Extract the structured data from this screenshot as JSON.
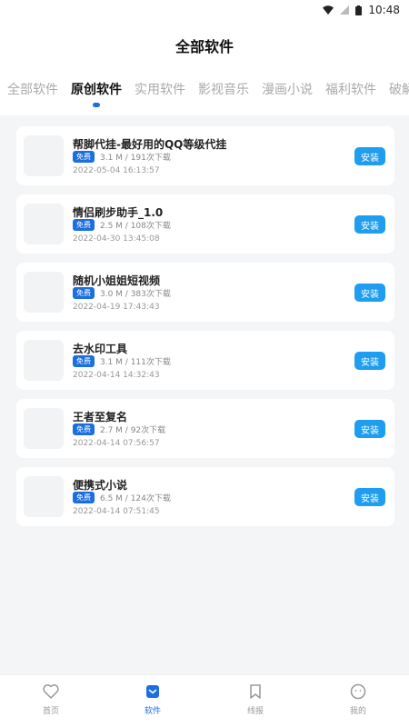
{
  "status_bar": {
    "time": "10:48"
  },
  "header": {
    "title": "全部软件"
  },
  "tabs": [
    {
      "label": "全部软件"
    },
    {
      "label": "原创软件"
    },
    {
      "label": "实用软件"
    },
    {
      "label": "影视音乐"
    },
    {
      "label": "漫画小说"
    },
    {
      "label": "福利软件"
    },
    {
      "label": "破解"
    }
  ],
  "active_tab": "原创软件",
  "items": [
    {
      "title": "帮脚代挂-最好用的QQ等级代挂",
      "badge": "免费",
      "meta": "3.1 M / 191次下载",
      "date": "2022-05-04 16:13:57",
      "install_label": "安装"
    },
    {
      "title": "情侣刷步助手_1.0",
      "badge": "免费",
      "meta": "2.5 M / 108次下载",
      "date": "2022-04-30 13:45:08",
      "install_label": "安装"
    },
    {
      "title": "随机小姐姐短视频",
      "badge": "免费",
      "meta": "3.0 M / 383次下载",
      "date": "2022-04-19 17:43:43",
      "install_label": "安装"
    },
    {
      "title": "去水印工具",
      "badge": "免费",
      "meta": "3.1 M / 111次下载",
      "date": "2022-04-14 14:32:43",
      "install_label": "安装"
    },
    {
      "title": "王者至复名",
      "badge": "免费",
      "meta": "2.7 M / 92次下载",
      "date": "2022-04-14 07:56:57",
      "install_label": "安装"
    },
    {
      "title": "便携式小说",
      "badge": "免费",
      "meta": "6.5 M / 124次下载",
      "date": "2022-04-14 07:51:45",
      "install_label": "安装"
    }
  ],
  "bottom_nav": [
    {
      "label": "首页",
      "icon": "heart-icon"
    },
    {
      "label": "软件",
      "icon": "software-icon"
    },
    {
      "label": "线报",
      "icon": "bookmark-icon"
    },
    {
      "label": "我的",
      "icon": "smile-icon"
    }
  ],
  "colors": {
    "accent": "#1b6fe0",
    "install": "#1f9ef0",
    "list_bg": "#f4f5f7"
  }
}
